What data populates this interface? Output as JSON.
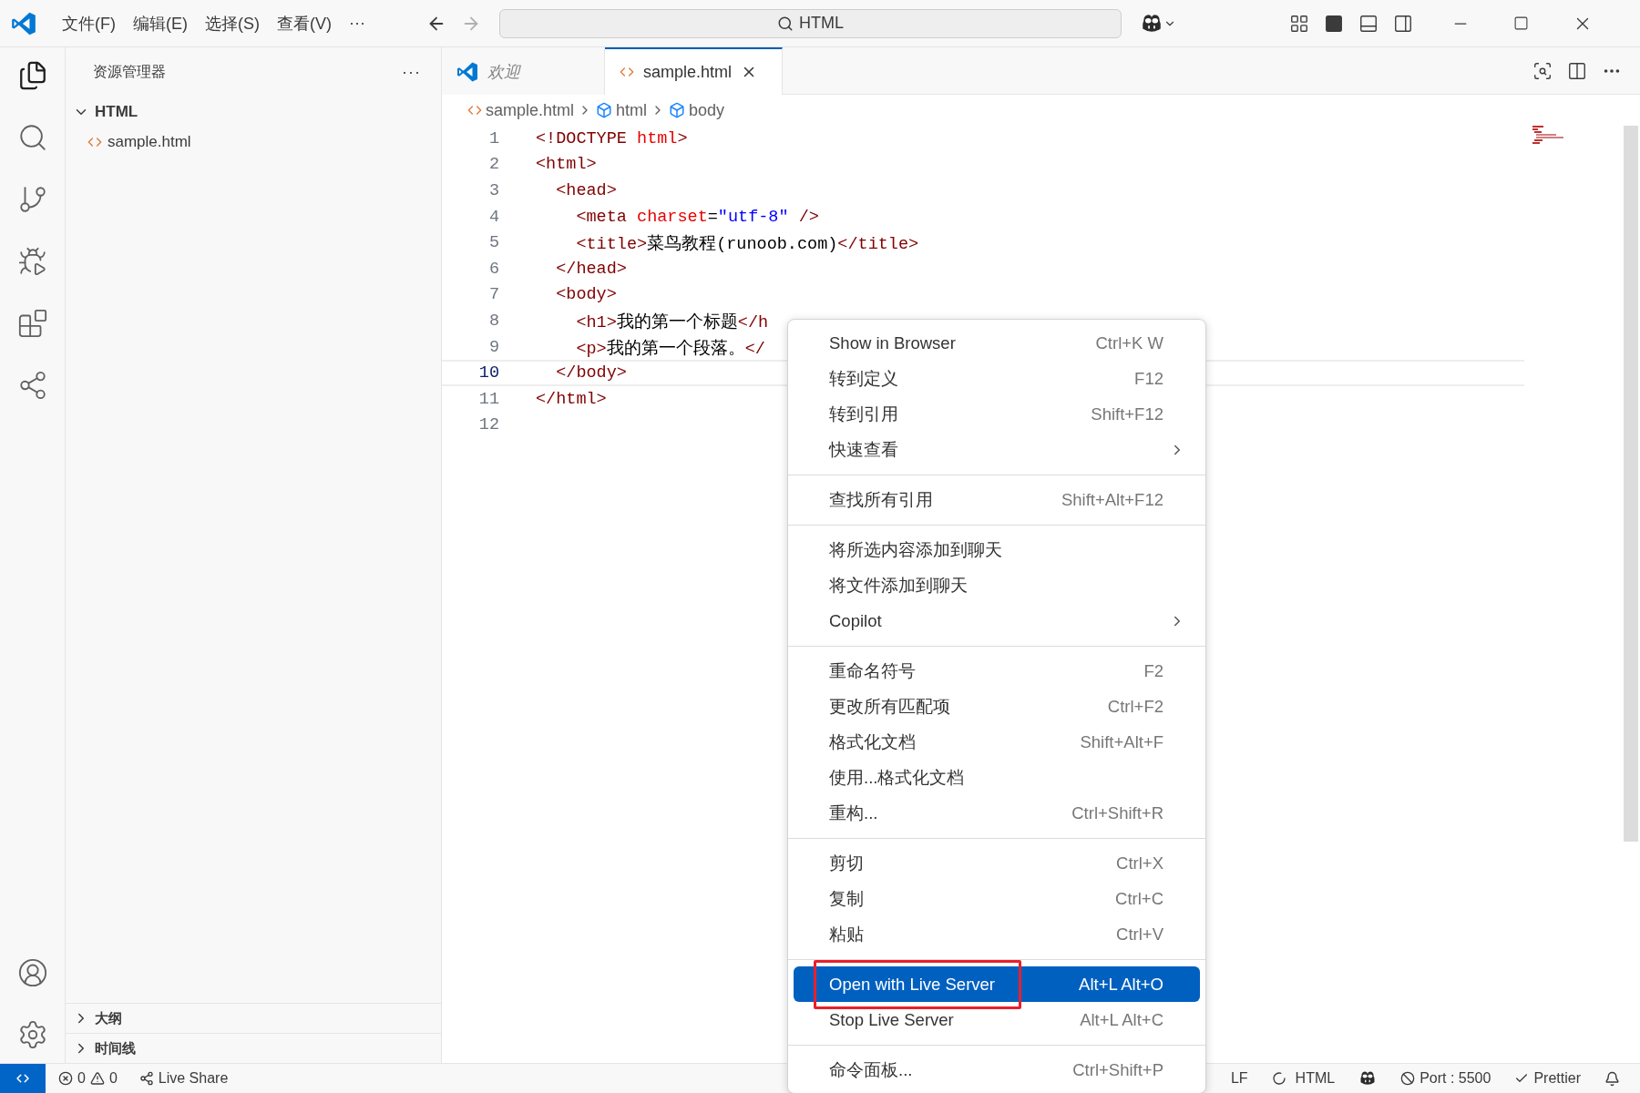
{
  "title_bar": {
    "menus": [
      "文件(F)",
      "编辑(E)",
      "选择(S)",
      "查看(V)",
      "···"
    ],
    "search": "HTML"
  },
  "activity_bar": {
    "top": [
      {
        "kind": "files",
        "selected": true
      },
      {
        "kind": "search",
        "selected": false
      },
      {
        "kind": "scm",
        "selected": false
      },
      {
        "kind": "debug",
        "selected": false
      },
      {
        "kind": "extensions",
        "selected": false
      },
      {
        "kind": "share",
        "selected": false
      }
    ],
    "bottom": [
      {
        "kind": "account",
        "selected": false
      },
      {
        "kind": "settings",
        "selected": false
      }
    ]
  },
  "sidebar": {
    "title": "资源管理器",
    "more": "···",
    "tree": [
      {
        "label": "HTML",
        "expanded": true,
        "children": [
          {
            "label": "sample.html",
            "kind": "html"
          }
        ]
      }
    ],
    "sections": [
      {
        "label": "大纲",
        "expanded": false
      },
      {
        "label": "时间线",
        "expanded": false
      }
    ]
  },
  "tabs": [
    {
      "label": "欢迎",
      "kind": "welcome",
      "selected": false
    },
    {
      "label": "sample.html",
      "kind": "html",
      "selected": true
    }
  ],
  "breadcrumb": [
    {
      "label": "sample.html",
      "kind": "file"
    },
    {
      "label": "html",
      "kind": "element"
    },
    {
      "label": "body",
      "kind": "element"
    }
  ],
  "editor": {
    "lines": [
      {
        "number": "1",
        "current": false,
        "tokens": [
          {
            "kind": "tag",
            "text": "<!DOCTYPE"
          },
          {
            "kind": "attribute",
            "text": " html"
          },
          {
            "kind": "tag",
            "text": ">"
          }
        ]
      },
      {
        "number": "2",
        "current": false,
        "tokens": [
          {
            "kind": "tag",
            "text": "<html>"
          }
        ]
      },
      {
        "number": "3",
        "current": false,
        "tokens": [
          {
            "kind": "tag",
            "text": "  <head>"
          }
        ]
      },
      {
        "number": "4",
        "current": false,
        "tokens": [
          {
            "kind": "tag",
            "text": "    <meta"
          },
          {
            "kind": "attribute",
            "text": " charset"
          },
          {
            "kind": "plain",
            "text": "="
          },
          {
            "kind": "value",
            "text": "\"utf-8\""
          },
          {
            "kind": "tag",
            "text": " />"
          }
        ]
      },
      {
        "number": "5",
        "current": false,
        "tokens": [
          {
            "kind": "tag",
            "text": "    <title>"
          },
          {
            "kind": "plain",
            "text": "菜鸟教程(runoob.com)"
          },
          {
            "kind": "tag",
            "text": "</title>"
          }
        ]
      },
      {
        "number": "6",
        "current": false,
        "tokens": [
          {
            "kind": "tag",
            "text": "  </head>"
          }
        ]
      },
      {
        "number": "7",
        "current": false,
        "tokens": [
          {
            "kind": "tag",
            "text": "  <body>"
          }
        ]
      },
      {
        "number": "8",
        "current": false,
        "tokens": [
          {
            "kind": "tag",
            "text": "    <h1>"
          },
          {
            "kind": "plain",
            "text": "我的第一个标题"
          },
          {
            "kind": "tag",
            "text": "</h"
          }
        ]
      },
      {
        "number": "9",
        "current": false,
        "tokens": [
          {
            "kind": "tag",
            "text": "    <p>"
          },
          {
            "kind": "plain",
            "text": "我的第一个段落。"
          },
          {
            "kind": "tag",
            "text": "</"
          }
        ]
      },
      {
        "number": "10",
        "current": true,
        "tokens": [
          {
            "kind": "tag",
            "text": "  </body>"
          }
        ]
      },
      {
        "number": "11",
        "current": false,
        "tokens": [
          {
            "kind": "tag",
            "text": "</html>"
          }
        ]
      },
      {
        "number": "12",
        "current": false
      }
    ]
  },
  "context_menu": {
    "groups": [
      {
        "items": [
          {
            "label": "Show in Browser",
            "shortcut": "Ctrl+K W",
            "submenu": false,
            "selected": false,
            "outlined": false
          },
          {
            "label": "转到定义",
            "shortcut": "F12",
            "submenu": false,
            "selected": false,
            "outlined": false
          },
          {
            "label": "转到引用",
            "shortcut": "Shift+F12",
            "submenu": false,
            "selected": false,
            "outlined": false
          },
          {
            "label": "快速查看",
            "submenu": true,
            "selected": false,
            "outlined": false
          }
        ]
      },
      {
        "items": [
          {
            "label": "查找所有引用",
            "shortcut": "Shift+Alt+F12",
            "submenu": false,
            "selected": false,
            "outlined": false
          }
        ]
      },
      {
        "items": [
          {
            "label": "将所选内容添加到聊天",
            "submenu": false,
            "selected": false,
            "outlined": false
          },
          {
            "label": "将文件添加到聊天",
            "submenu": false,
            "selected": false,
            "outlined": false
          },
          {
            "label": "Copilot",
            "submenu": true,
            "selected": false,
            "outlined": false
          }
        ]
      },
      {
        "items": [
          {
            "label": "重命名符号",
            "shortcut": "F2",
            "submenu": false,
            "selected": false,
            "outlined": false
          },
          {
            "label": "更改所有匹配项",
            "shortcut": "Ctrl+F2",
            "submenu": false,
            "selected": false,
            "outlined": false
          },
          {
            "label": "格式化文档",
            "shortcut": "Shift+Alt+F",
            "submenu": false,
            "selected": false,
            "outlined": false
          },
          {
            "label": "使用...格式化文档",
            "submenu": false,
            "selected": false,
            "outlined": false
          },
          {
            "label": "重构...",
            "shortcut": "Ctrl+Shift+R",
            "submenu": false,
            "selected": false,
            "outlined": false
          }
        ]
      },
      {
        "items": [
          {
            "label": "剪切",
            "shortcut": "Ctrl+X",
            "submenu": false,
            "selected": false,
            "outlined": false
          },
          {
            "label": "复制",
            "shortcut": "Ctrl+C",
            "submenu": false,
            "selected": false,
            "outlined": false
          },
          {
            "label": "粘贴",
            "shortcut": "Ctrl+V",
            "submenu": false,
            "selected": false,
            "outlined": false
          }
        ]
      },
      {
        "items": [
          {
            "label": "Open with Live Server",
            "shortcut": "Alt+L Alt+O",
            "submenu": false,
            "selected": true,
            "outlined": true
          },
          {
            "label": "Stop Live Server",
            "shortcut": "Alt+L Alt+C",
            "submenu": false,
            "selected": false,
            "outlined": false
          }
        ]
      },
      {
        "items": [
          {
            "label": "命令面板...",
            "shortcut": "Ctrl+Shift+P",
            "submenu": false,
            "selected": false,
            "outlined": false
          }
        ]
      }
    ]
  },
  "status_bar": {
    "errors": "0",
    "warnings": "0",
    "live_share": "Live Share",
    "eol": "LF",
    "language": "HTML",
    "port": "Port : 5500",
    "prettier": "Prettier"
  }
}
